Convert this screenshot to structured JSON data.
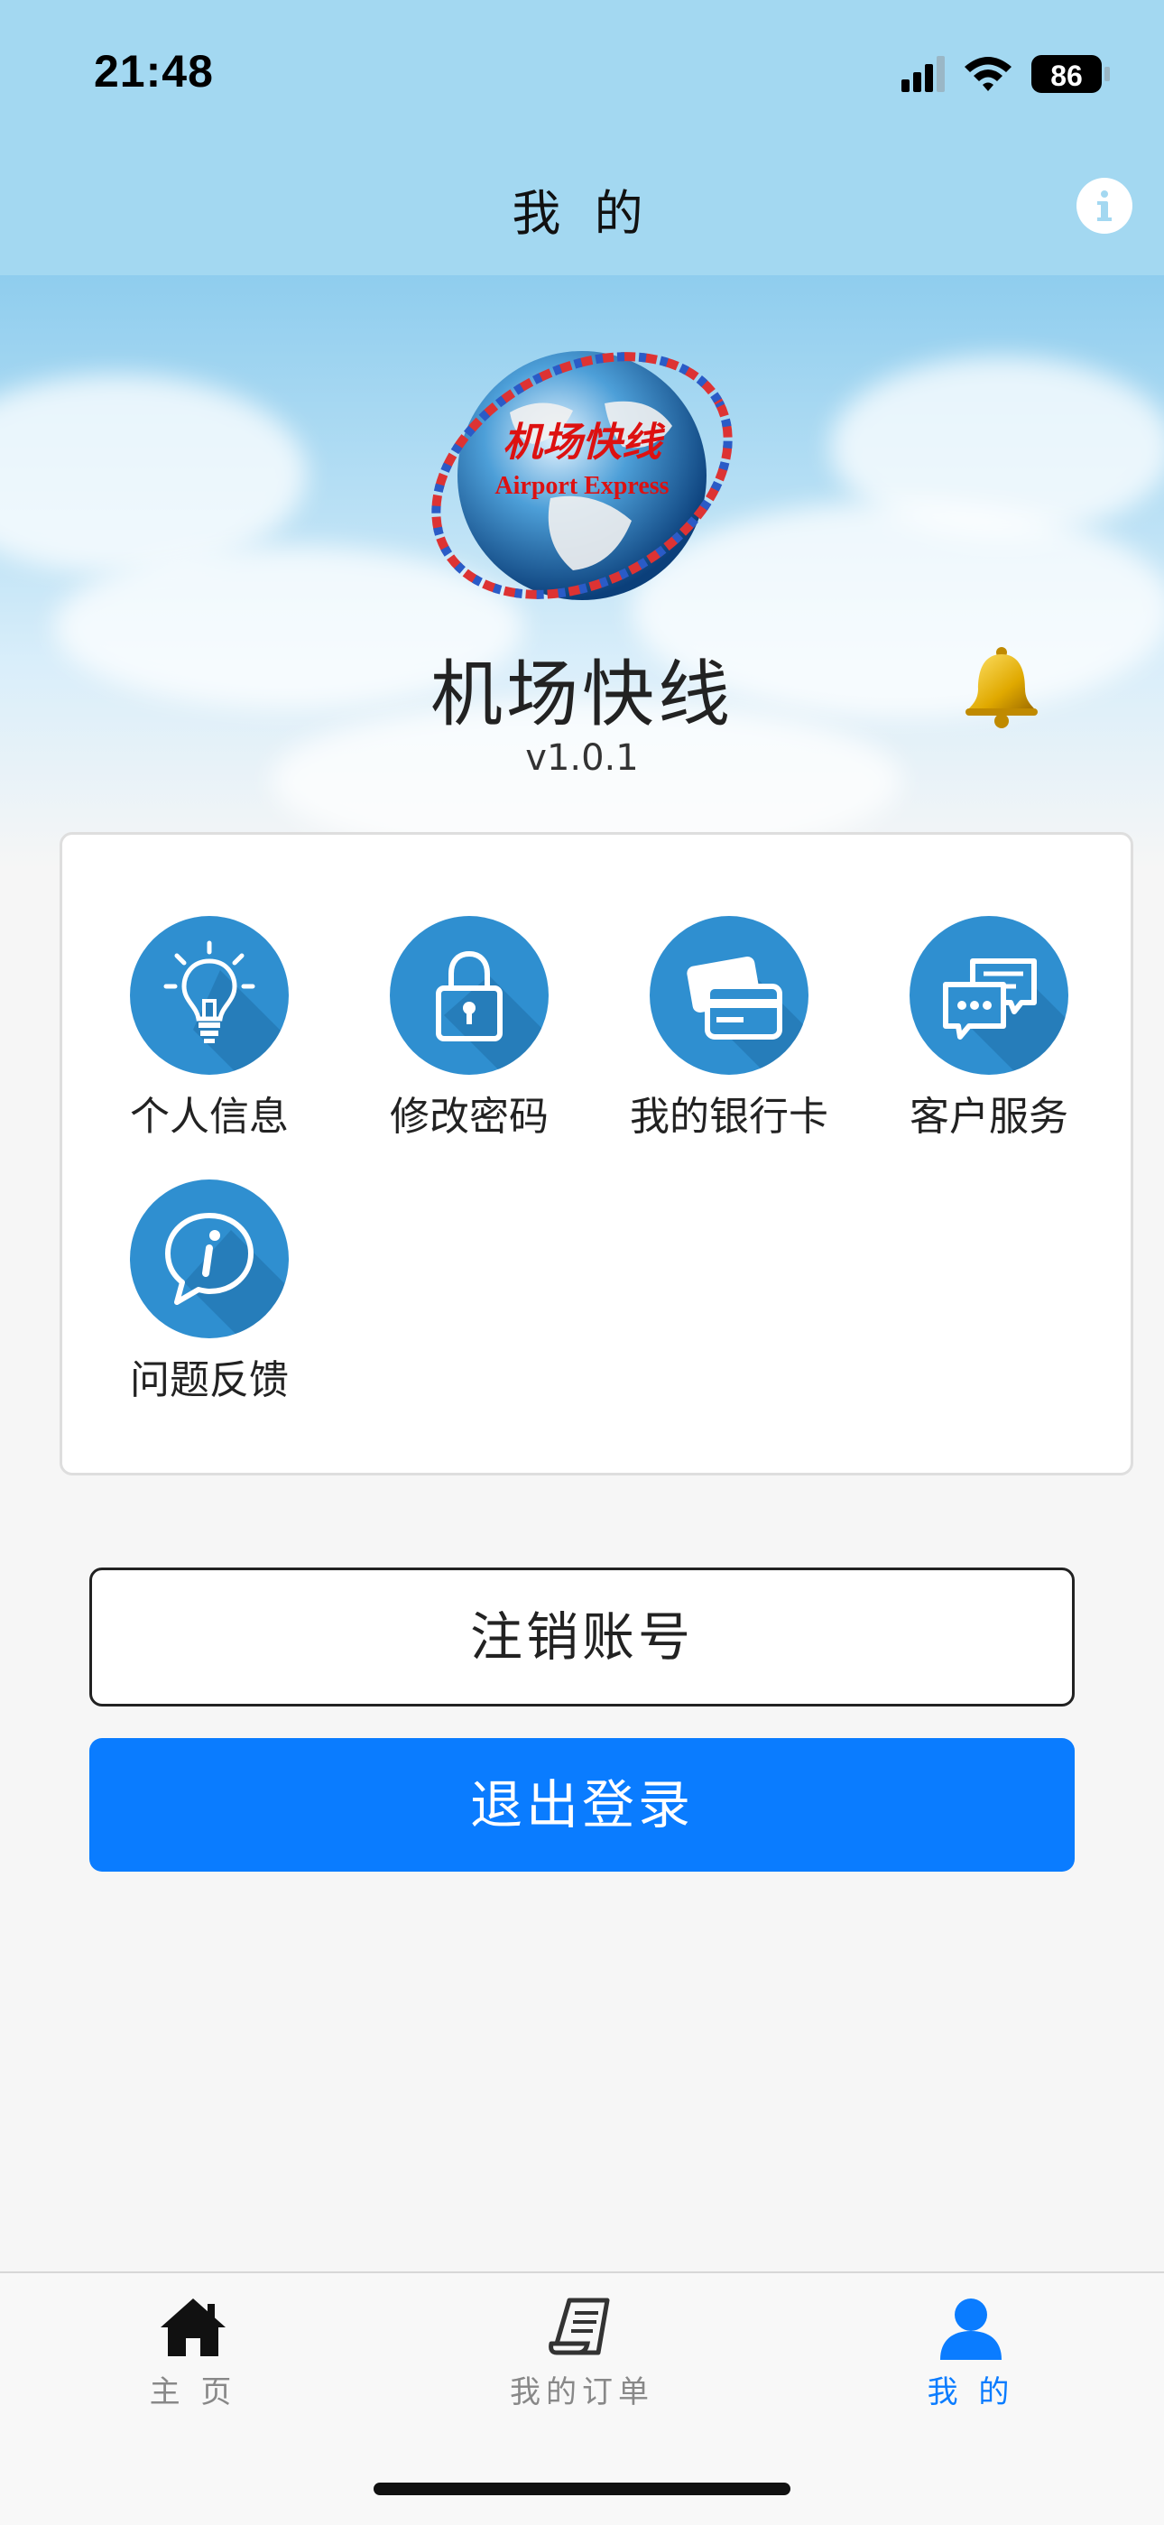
{
  "status_bar": {
    "time": "21:48",
    "battery": "86"
  },
  "nav": {
    "title": "我 的",
    "info_icon": "info-icon"
  },
  "hero": {
    "logo_text_cn": "机场快线",
    "logo_text_en": "Airport Express",
    "app_name": "机场快线",
    "version": "v1.0.1"
  },
  "menu": {
    "items": [
      {
        "label": "个人信息",
        "icon": "lightbulb-icon"
      },
      {
        "label": "修改密码",
        "icon": "lock-icon"
      },
      {
        "label": "我的银行卡",
        "icon": "bank-card-icon"
      },
      {
        "label": "客户服务",
        "icon": "chat-bubbles-icon"
      },
      {
        "label": "问题反馈",
        "icon": "info-bubble-icon"
      }
    ]
  },
  "actions": {
    "deactivate_label": "注销账号",
    "logout_label": "退出登录"
  },
  "tabbar": {
    "tabs": [
      {
        "label": "主 页",
        "icon": "home-icon",
        "active": false
      },
      {
        "label": "我的订单",
        "icon": "order-document-icon",
        "active": false
      },
      {
        "label": "我 的",
        "icon": "person-icon",
        "active": true
      }
    ]
  },
  "colors": {
    "accent": "#0a7cff",
    "header_bg": "#a3d8f1",
    "menu_icon_bg": "#2f8fd0"
  }
}
